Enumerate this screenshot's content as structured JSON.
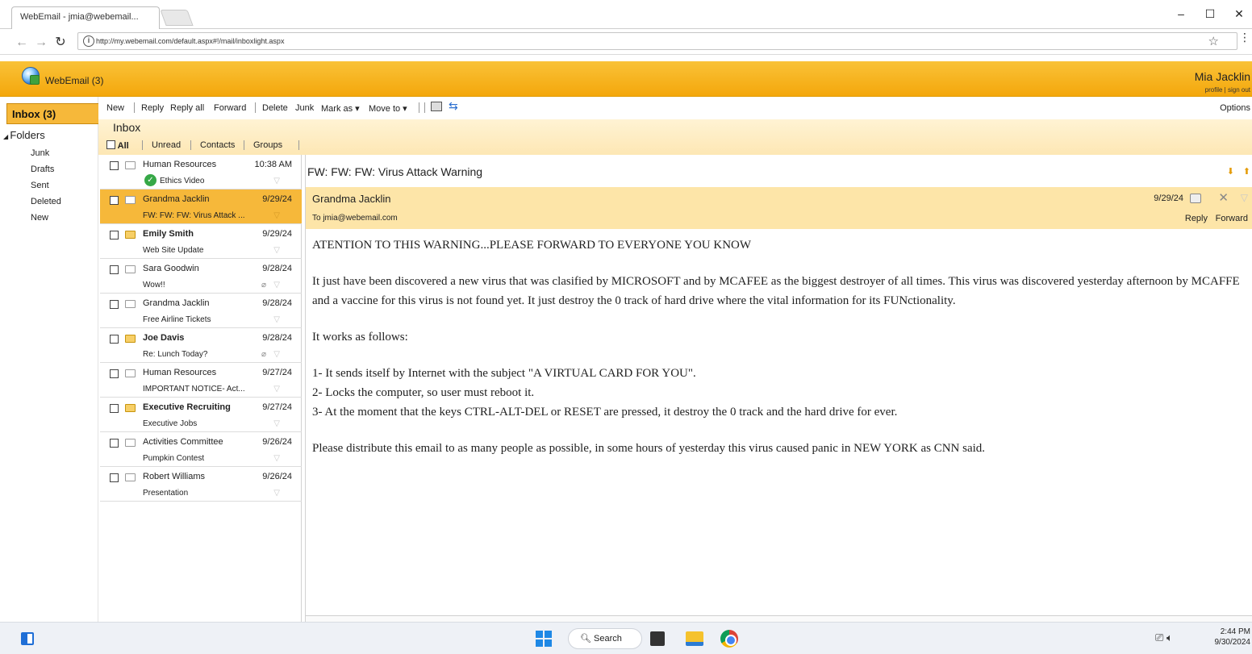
{
  "browser": {
    "tab_title": "WebEmail - jmia@webemail...",
    "url": "http://my.webemail.com/default.aspx#!/mail/inboxlight.aspx",
    "window_controls": [
      "–",
      "☐",
      "✕"
    ]
  },
  "app": {
    "title": "WebEmail (3)",
    "user_name": "Mia Jacklin",
    "user_links": "profile | sign out",
    "accent": "#f6b83a"
  },
  "sidebar": {
    "inbox_label": "Inbox (3)",
    "folders_label": "Folders",
    "folders": [
      "Junk",
      "Drafts",
      "Sent",
      "Deleted",
      "New"
    ]
  },
  "toolbar": {
    "new": "New",
    "reply": "Reply",
    "reply_all": "Reply all",
    "forward": "Forward",
    "delete": "Delete",
    "junk": "Junk",
    "mark_as": "Mark as ▾",
    "move_to": "Move to ▾",
    "options": "Options"
  },
  "inbox": {
    "title": "Inbox",
    "filters": [
      "All",
      "Unread",
      "Contacts",
      "Groups"
    ]
  },
  "messages": [
    {
      "sender": "Human Resources",
      "date": "10:38 AM",
      "subject": "Ethics Video",
      "unread": false,
      "attachment": false,
      "verified": true
    },
    {
      "sender": "Grandma Jacklin",
      "date": "9/29/24",
      "subject": "FW: FW: FW: Virus Attack ...",
      "unread": false,
      "attachment": false,
      "selected": true
    },
    {
      "sender": "Emily Smith",
      "date": "9/29/24",
      "subject": "Web Site Update",
      "unread": true,
      "attachment": false
    },
    {
      "sender": "Sara Goodwin",
      "date": "9/28/24",
      "subject": "Wow!!",
      "unread": false,
      "attachment": true
    },
    {
      "sender": "Grandma Jacklin",
      "date": "9/28/24",
      "subject": "Free Airline Tickets",
      "unread": false,
      "attachment": false
    },
    {
      "sender": "Joe Davis",
      "date": "9/28/24",
      "subject": "Re: Lunch Today?",
      "unread": true,
      "attachment": true
    },
    {
      "sender": "Human Resources",
      "date": "9/27/24",
      "subject": "IMPORTANT NOTICE- Act...",
      "unread": false,
      "attachment": false
    },
    {
      "sender": "Executive Recruiting",
      "date": "9/27/24",
      "subject": "Executive Jobs",
      "unread": true,
      "attachment": false
    },
    {
      "sender": "Activities Committee",
      "date": "9/26/24",
      "subject": "Pumpkin Contest",
      "unread": false,
      "attachment": false
    },
    {
      "sender": "Robert Williams",
      "date": "9/26/24",
      "subject": "Presentation",
      "unread": false,
      "attachment": false
    }
  ],
  "reader": {
    "subject": "FW: FW: FW: Virus Attack Warning",
    "from": "Grandma Jacklin",
    "to": "To jmia@webemail.com",
    "date": "9/29/24",
    "reply": "Reply",
    "forward": "Forward",
    "body": [
      "ATENTION TO THIS WARNING...PLEASE FORWARD TO EVERYONE YOU KNOW",
      "",
      "It just have been discovered a new virus that was clasified by MICROSOFT and by MCAFEE as the biggest destroyer of all times. This virus was discovered yesterday afternoon by MCAFFE and a vaccine for this virus is not found yet. It just destroy the 0 track of hard drive where the vital information for its FUNctionality.",
      "",
      "It works as follows:",
      "",
      "1- It sends itself by Internet with the subject \"A VIRTUAL CARD FOR YOU\".",
      "2- Locks the computer, so user must reboot it.",
      "3- At the moment that the keys CTRL-ALT-DEL or RESET are pressed, it destroy the 0 track and the hard drive for ever.",
      "",
      "Please distribute this email to as many people as possible, in some hours of yesterday this virus caused panic in NEW YORK as CNN said."
    ]
  },
  "taskbar": {
    "search": "Search",
    "time": "2:44 PM",
    "date": "9/30/2024"
  }
}
